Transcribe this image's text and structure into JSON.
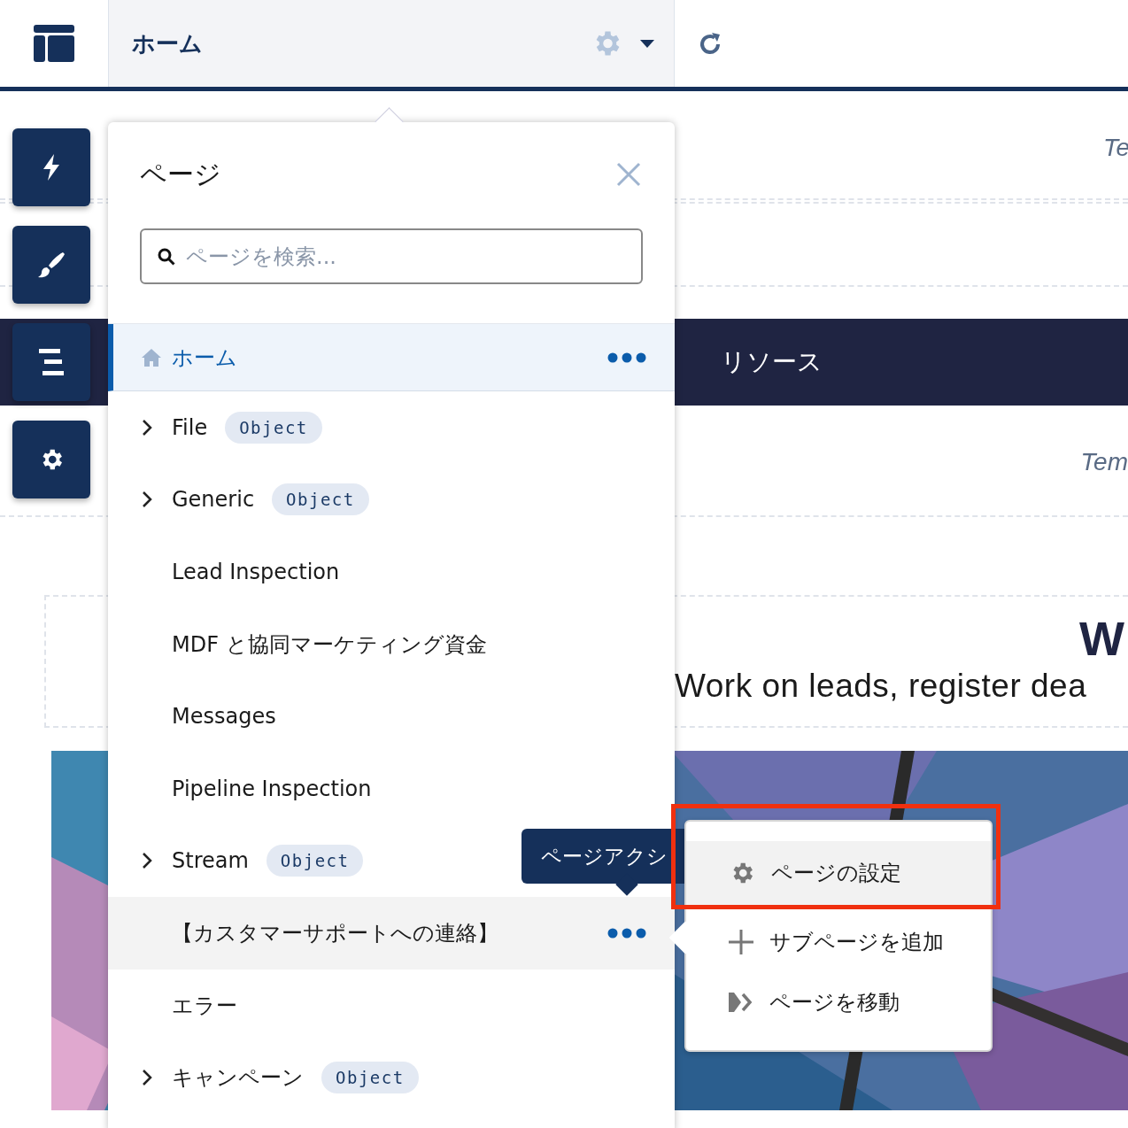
{
  "topbar": {
    "page_title": "ホーム"
  },
  "canvas": {
    "section_label_1": "Te",
    "nav_items": [
      "リソース"
    ],
    "section_label_2": "Tem",
    "hero_heading": "W",
    "hero_text": "Work on leads, register dea"
  },
  "tools": [
    {
      "kind": "bolt"
    },
    {
      "kind": "brush"
    },
    {
      "kind": "lines"
    },
    {
      "kind": "gear"
    }
  ],
  "pages_panel": {
    "title": "ページ",
    "search": {
      "placeholder": "ページを検索..."
    },
    "items": [
      {
        "kind": "home",
        "label": "ホーム",
        "selected": true,
        "hovered": false
      },
      {
        "kind": "group",
        "label": "File",
        "badge": "Object",
        "selected": false,
        "hovered": false
      },
      {
        "kind": "group",
        "label": "Generic",
        "badge": "Object",
        "selected": false,
        "hovered": false
      },
      {
        "kind": "page",
        "label": "Lead Inspection",
        "selected": false,
        "hovered": false
      },
      {
        "kind": "page",
        "label": "MDF と協同マーケティング資金",
        "selected": false,
        "hovered": false
      },
      {
        "kind": "page",
        "label": "Messages",
        "selected": false,
        "hovered": false
      },
      {
        "kind": "page",
        "label": "Pipeline Inspection",
        "selected": false,
        "hovered": false
      },
      {
        "kind": "group",
        "label": "Stream",
        "badge": "Object",
        "selected": false,
        "hovered": false
      },
      {
        "kind": "page",
        "label": "【カスタマーサポートへの連絡】",
        "selected": false,
        "hovered": true
      },
      {
        "kind": "page",
        "label": "エラー",
        "selected": false,
        "hovered": false
      },
      {
        "kind": "group",
        "label": "キャンペーン",
        "badge": "Object",
        "selected": false,
        "hovered": false
      }
    ]
  },
  "tooltip": {
    "text": "ページアクシ"
  },
  "action_menu": {
    "items": [
      {
        "kind": "settings",
        "label": "ページの設定",
        "selected": true
      },
      {
        "kind": "add",
        "label": "サブページを追加",
        "selected": false
      },
      {
        "kind": "move",
        "label": "ページを移動",
        "selected": false
      }
    ]
  }
}
